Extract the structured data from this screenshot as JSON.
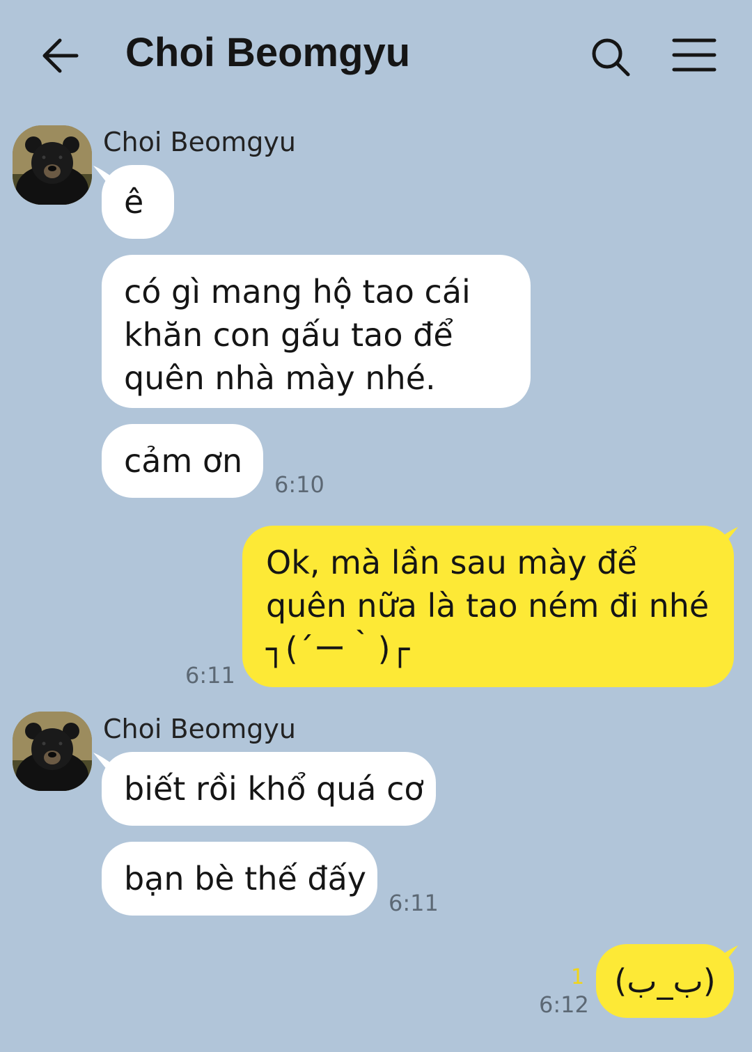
{
  "header": {
    "title": "Choi Beomgyu",
    "back_icon": "arrow-left-icon",
    "search_icon": "search-icon",
    "menu_icon": "hamburger-menu-icon"
  },
  "colors": {
    "background": "#b1c5d9",
    "incoming_bubble": "#ffffff",
    "outgoing_bubble": "#fde936",
    "read_count": "#f2d516"
  },
  "messages": [
    {
      "direction": "incoming",
      "sender": "Choi Beomgyu",
      "bubbles": [
        "ê",
        "có gì mang hộ tao cái\nkhăn con gấu tao để\nquên nhà mày nhé.",
        "cảm ơn"
      ],
      "time": "6:10"
    },
    {
      "direction": "outgoing",
      "bubbles": [
        "Ok, mà lần sau mày để\nquên nữa là tao ném đi nhé\n┐(´ー｀)┌"
      ],
      "time": "6:11"
    },
    {
      "direction": "incoming",
      "sender": "Choi Beomgyu",
      "bubbles": [
        "biết rồi khổ quá cơ",
        "bạn bè thế đấy"
      ],
      "time": "6:11"
    },
    {
      "direction": "outgoing",
      "bubbles": [
        "(ب_ب)"
      ],
      "time": "6:12",
      "unread_count": "1"
    }
  ]
}
